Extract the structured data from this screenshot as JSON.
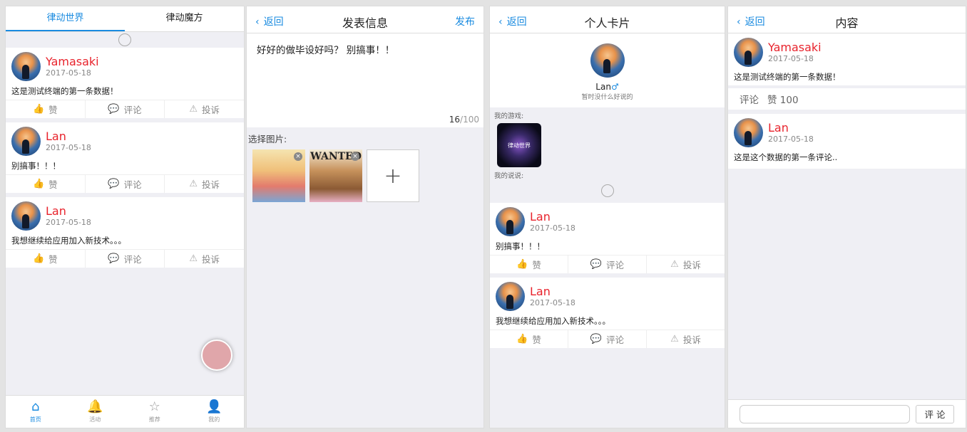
{
  "p1": {
    "tabs": [
      "律动世界",
      "律动魔方"
    ],
    "posts": [
      {
        "name": "Yamasaki",
        "date": "2017-05-18",
        "text": "这是测试终端的第一条数据！"
      },
      {
        "name": "Lan",
        "date": "2017-05-18",
        "text": "别搞事！！！"
      },
      {
        "name": "Lan",
        "date": "2017-05-18",
        "text": "我想继续给应用加入新技术。。。"
      }
    ],
    "actions": {
      "like": "赞",
      "comment": "评论",
      "report": "投诉"
    },
    "nav": [
      "首页",
      "活动",
      "推荐",
      "我的"
    ]
  },
  "p2": {
    "back": "返回",
    "title": "发表信息",
    "publish": "发布",
    "content": "好好的做毕设好吗？ 别搞事！！",
    "count": "16",
    "max": "/100",
    "pick_label": "选择图片:",
    "wanted": "WANTED"
  },
  "p3": {
    "back": "返回",
    "title": "个人卡片",
    "name": "Lan",
    "gender": "♂",
    "signature": "暂时没什么好说的",
    "games_label": "我的游戏:",
    "game_text": "律动世界",
    "says_label": "我的说说:",
    "posts": [
      {
        "name": "Lan",
        "date": "2017-05-18",
        "text": "别搞事！！！"
      },
      {
        "name": "Lan",
        "date": "2017-05-18",
        "text": "我想继续给应用加入新技术。。。"
      }
    ],
    "actions": {
      "like": "赞",
      "comment": "评论",
      "report": "投诉"
    }
  },
  "p4": {
    "back": "返回",
    "title": "内容",
    "post": {
      "name": "Yamasaki",
      "date": "2017-05-18",
      "text": "这是测试终端的第一条数据！"
    },
    "comment_label": "评论",
    "like_label": "赞 100",
    "comment": {
      "name": "Lan",
      "date": "2017-05-18",
      "text": "这是这个数据的第一条评论.."
    },
    "send_label": "评 论"
  },
  "colors": {
    "accent": "#1a8be0",
    "name": "#e8232c",
    "fab": "#e0a6aa"
  }
}
